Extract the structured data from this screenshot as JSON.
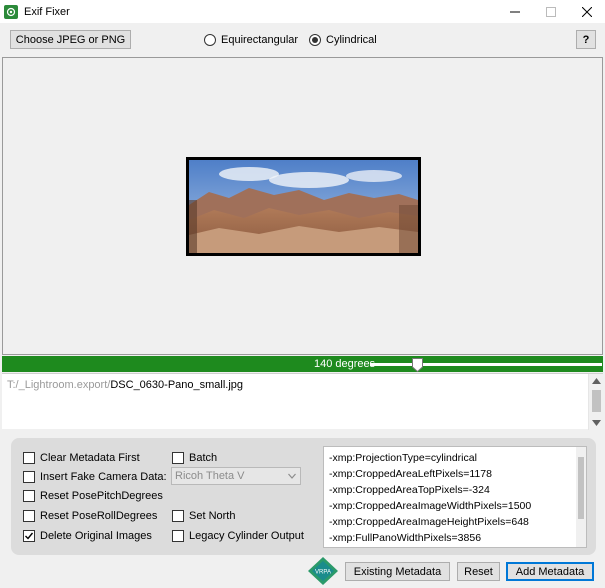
{
  "window": {
    "title": "Exif Fixer",
    "controls": {
      "minimize_icon": "minimize-icon",
      "maximize_icon": "maximize-icon",
      "close_icon": "close-icon"
    }
  },
  "toolbar": {
    "choose_label": "Choose JPEG or PNG",
    "projection_options": [
      {
        "label": "Equirectangular",
        "selected": false
      },
      {
        "label": "Cylindrical",
        "selected": true
      }
    ],
    "help_label": "?"
  },
  "preview": {
    "image": "panorama-thumbnail"
  },
  "slider": {
    "label": "140 degrees",
    "value_degrees": 140
  },
  "file_path": {
    "dim_part": "T:/_Lightroom.export/",
    "file_name": "DSC_0630-Pano_small.jpg"
  },
  "options": {
    "clear_metadata": {
      "label": "Clear Metadata First",
      "checked": false
    },
    "fake_camera": {
      "label": "Insert Fake Camera Data:",
      "checked": false
    },
    "camera_select": {
      "value": "Ricoh Theta V"
    },
    "reset_pitch": {
      "label": "Reset PosePitchDegrees",
      "checked": false
    },
    "reset_roll": {
      "label": "Reset PoseRollDegrees",
      "checked": false
    },
    "delete_originals": {
      "label": "Delete Original Images",
      "checked": true
    },
    "batch": {
      "label": "Batch",
      "checked": false
    },
    "set_north": {
      "label": "Set North",
      "checked": false
    },
    "legacy_cylinder": {
      "label": "Legacy Cylinder Output",
      "checked": false
    }
  },
  "metadata_lines": [
    "-xmp:ProjectionType=cylindrical",
    "-xmp:CroppedAreaLeftPixels=1178",
    "-xmp:CroppedAreaTopPixels=-324",
    "-xmp:CroppedAreaImageWidthPixels=1500",
    "-xmp:CroppedAreaImageHeightPixels=648",
    "-xmp:FullPanoWidthPixels=3856"
  ],
  "footer": {
    "logo_text": "VRPA",
    "existing_label": "Existing Metadata",
    "reset_label": "Reset",
    "add_label": "Add Metadata"
  },
  "colors": {
    "slider_green": "#1e8a1e",
    "accent_blue": "#0078d7",
    "logo_teal": "#1a8c8c"
  }
}
